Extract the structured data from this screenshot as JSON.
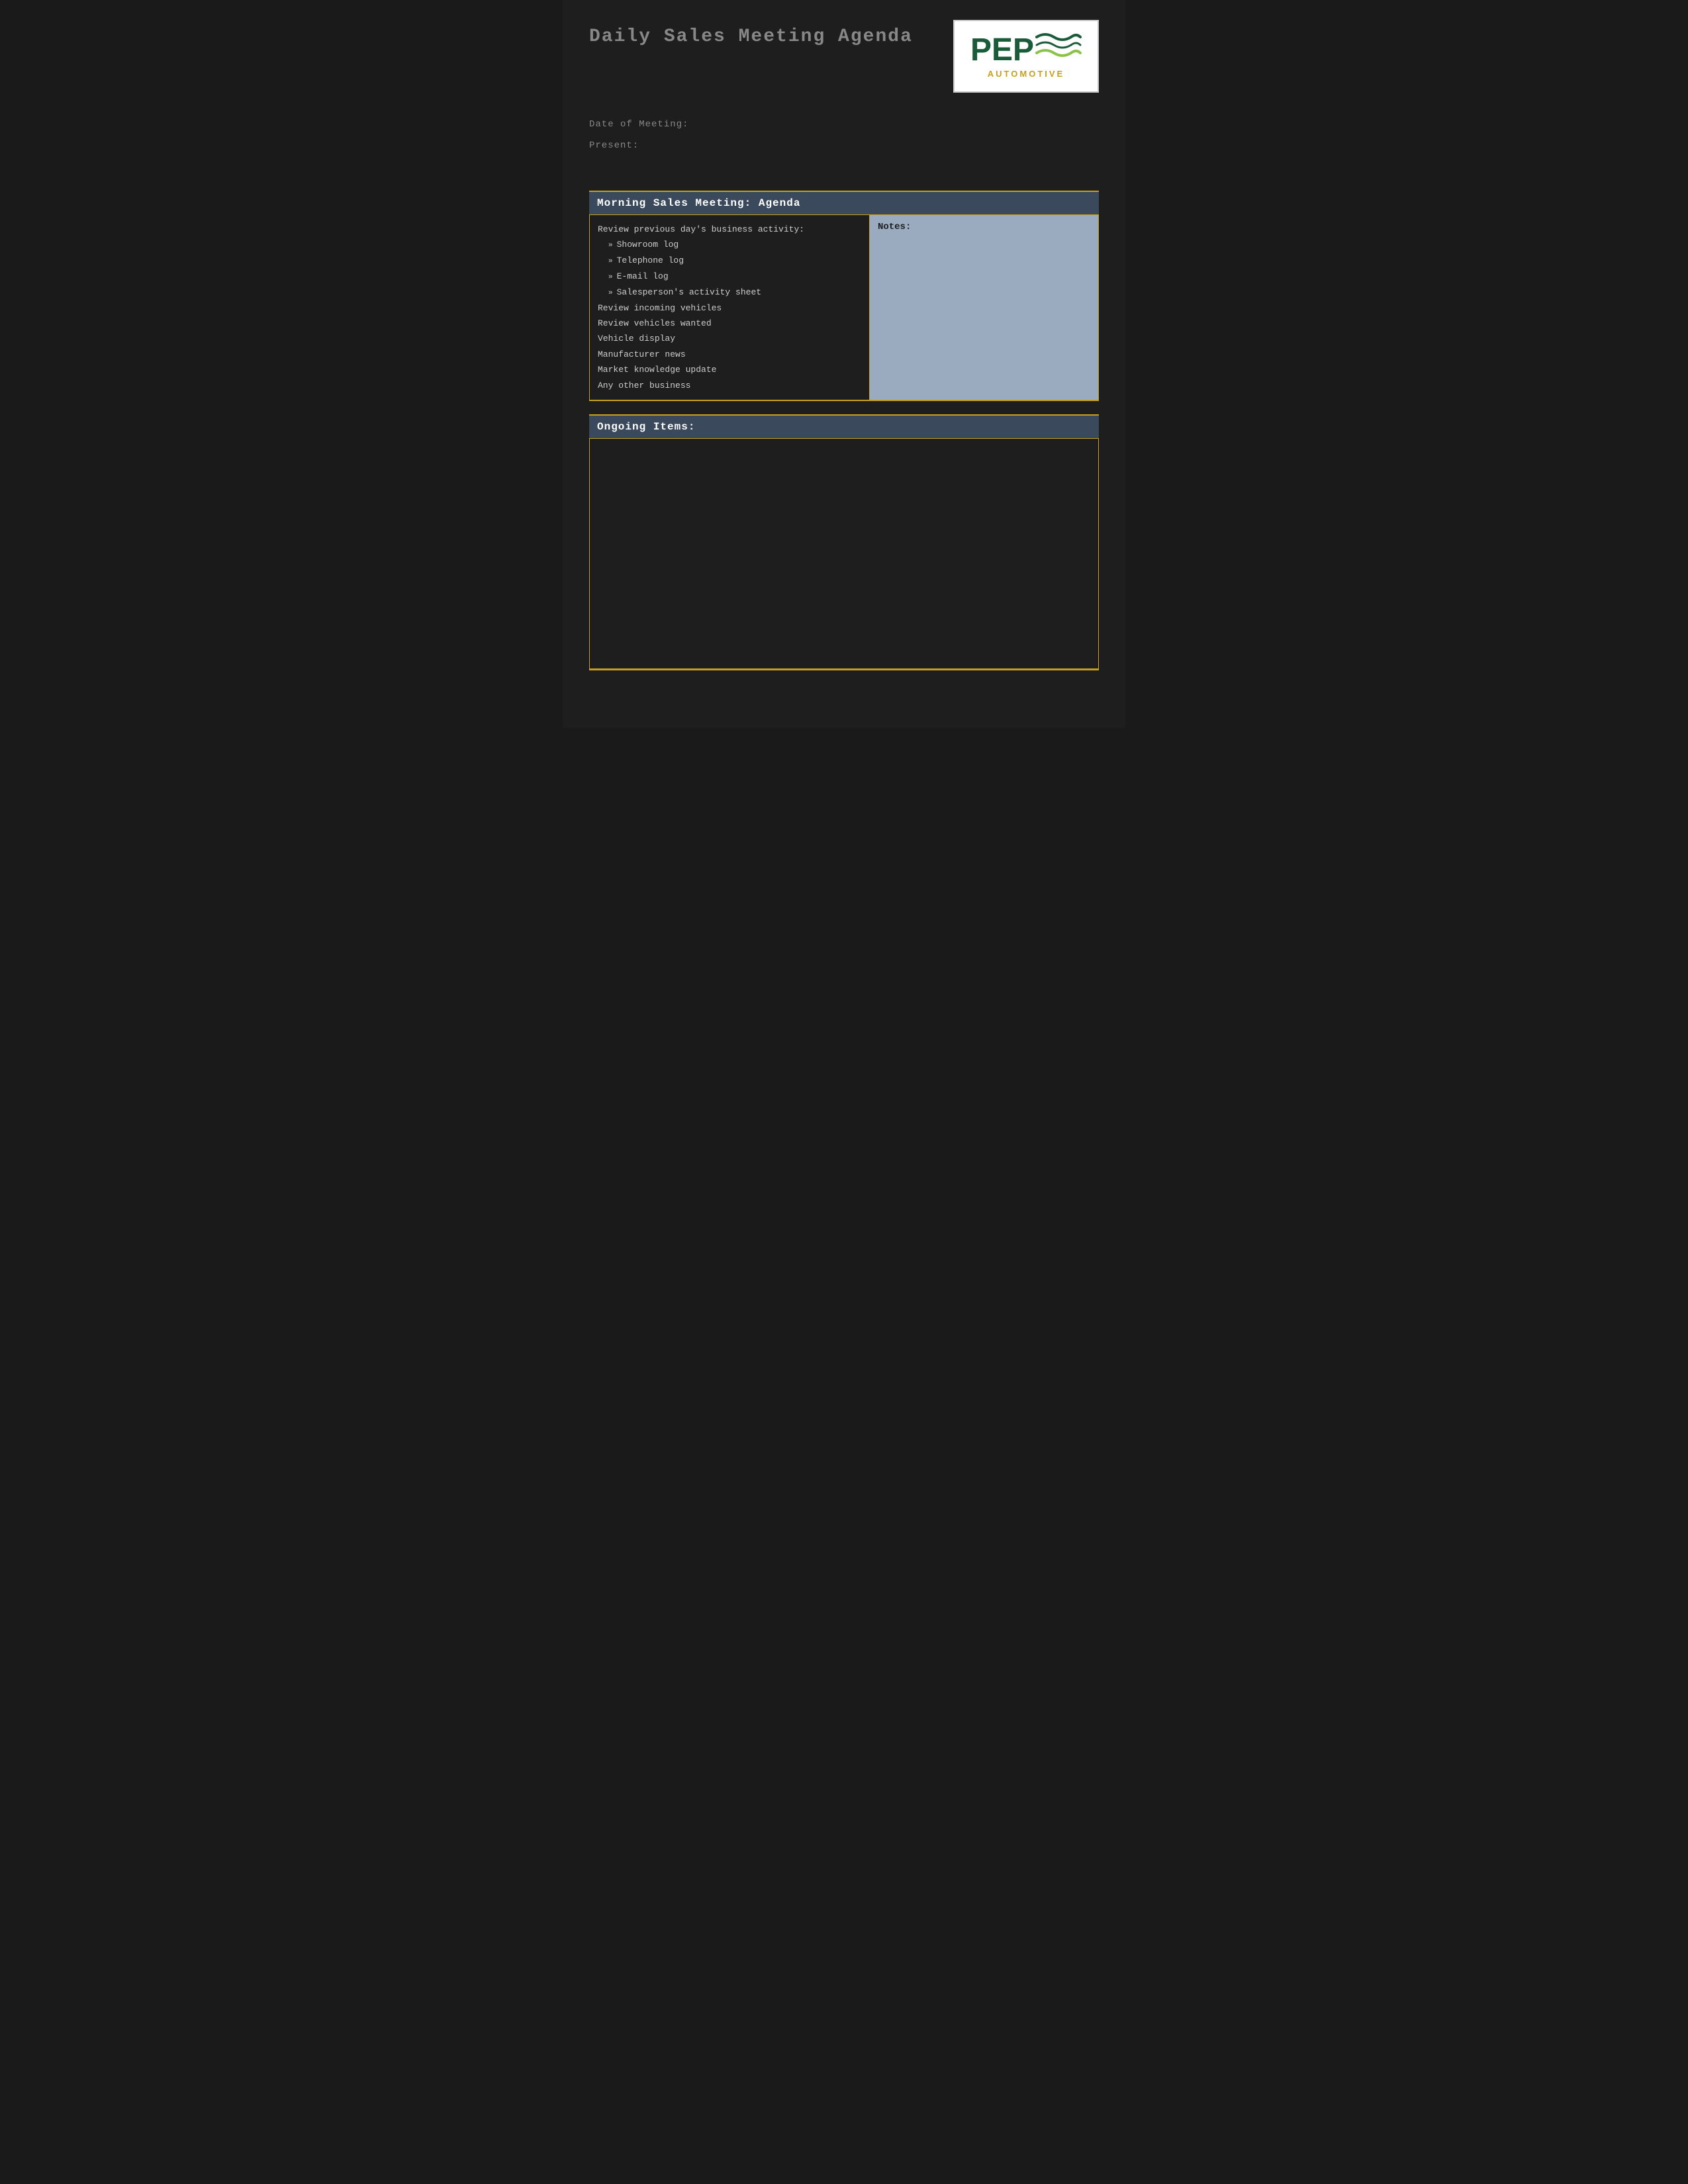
{
  "header": {
    "title": "Daily Sales Meeting Agenda",
    "logo": {
      "company_name": "PEP",
      "tagline": "AUTOMOTIVE"
    }
  },
  "meta": {
    "date_label": "Date of Meeting:",
    "present_label": "Present:"
  },
  "morning_meeting": {
    "section_title": "Morning Sales Meeting: Agenda",
    "agenda": {
      "review_title": "Review previous day's business activity:",
      "sub_items": [
        "Showroom log",
        "Telephone log",
        "E-mail log",
        "Salesperson's activity sheet"
      ],
      "main_items": [
        "Review incoming vehicles",
        "Review vehicles wanted",
        "Vehicle display",
        "Manufacturer news",
        "Market knowledge update",
        "Any other business"
      ]
    },
    "notes_label": "Notes:"
  },
  "ongoing": {
    "section_title": "Ongoing Items:"
  }
}
